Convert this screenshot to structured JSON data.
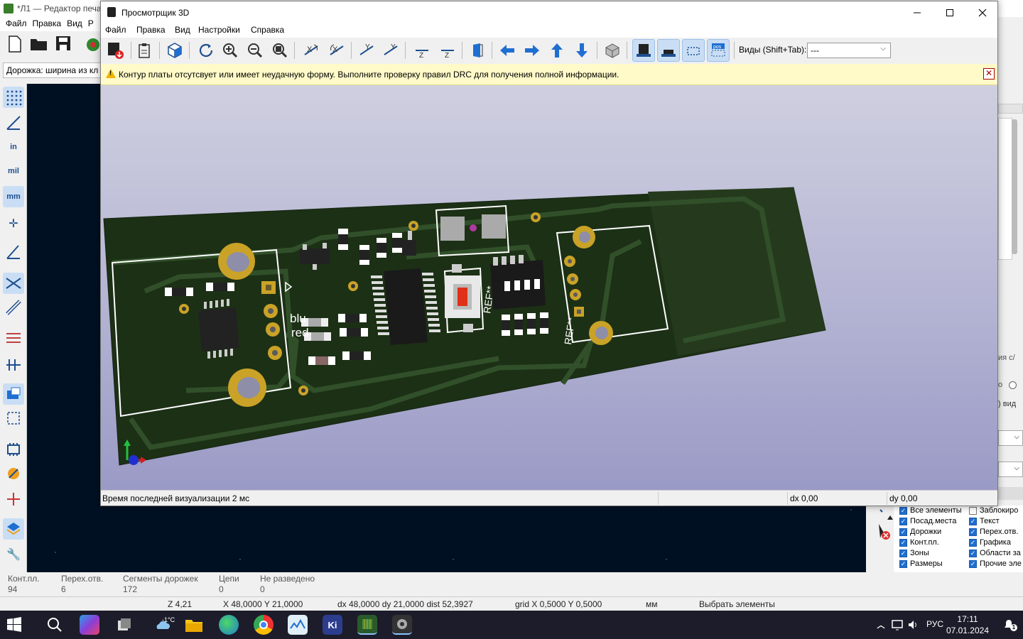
{
  "pcb_editor": {
    "title": "*Л1 — Редактор печа",
    "menu": [
      "Файл",
      "Правка",
      "Вид",
      "Р"
    ],
    "track_width": "Дорожка: ширина из кл",
    "stats": [
      {
        "label": "Конт.пл.",
        "value": "94"
      },
      {
        "label": "Перех.отв.",
        "value": "6"
      },
      {
        "label": "Сегменты дорожек",
        "value": "172"
      },
      {
        "label": "Цепи",
        "value": "0"
      },
      {
        "label": "Не разведено",
        "value": "0"
      }
    ],
    "status": {
      "zoom": "Z 4,21",
      "xy": "X 48,0000  Y 21,0000",
      "delta": "dx 48,0000  dy 21,0000  dist 52,3927",
      "grid": "grid X 0,5000  Y 0,5000",
      "units": "мм",
      "mode": "Выбрать элементы"
    },
    "right_panel_fragments": [
      "ия с/",
      "о",
      ") вид"
    ],
    "layers": {
      "left": [
        "Все элементы",
        "Посад.места",
        "Дорожки",
        "Конт.пл.",
        "Зоны",
        "Размеры"
      ],
      "right": [
        {
          "label": "Заблокиро",
          "checked": false
        },
        {
          "label": "Текст",
          "checked": true
        },
        {
          "label": "Перех.отв.",
          "checked": true
        },
        {
          "label": "Графика",
          "checked": true
        },
        {
          "label": "Области за",
          "checked": true
        },
        {
          "label": "Прочие эле",
          "checked": true
        }
      ]
    }
  },
  "viewer": {
    "title": "Просмотрщик 3D",
    "menu": [
      "Файл",
      "Правка",
      "Вид",
      "Настройки",
      "Справка"
    ],
    "views_label": "Виды (Shift+Tab):",
    "views_value": "---",
    "warning": "Контур платы отсутсвует или имеет неудачную форму. Выполните проверку правил DRC для получения полной информации.",
    "status_left": "Время последней визуализации 2 мс",
    "status_dx": "dx 0,00",
    "status_dy": "dy 0,00",
    "board": {
      "ref1": "REF**",
      "ref2": "REF**",
      "label_blu": "blu",
      "label_red": "red"
    }
  },
  "taskbar": {
    "weather": "-1°C",
    "lang": "РУС",
    "time": "17:11",
    "date": "07.01.2024",
    "notif": "1",
    "kicad": "Ki"
  },
  "colors": {
    "board": "#1e3317",
    "copper_pad": "#c9a227",
    "silk": "#ffffff",
    "canvas_bg": "#001023",
    "accent": "#1f6fd1"
  }
}
